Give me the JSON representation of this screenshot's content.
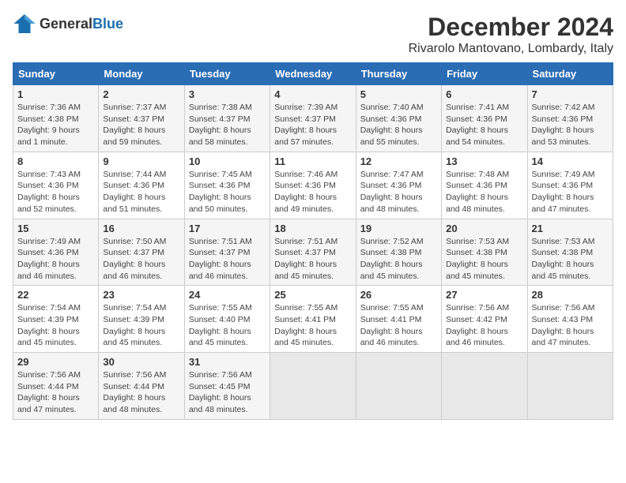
{
  "header": {
    "logo_general": "General",
    "logo_blue": "Blue",
    "title": "December 2024",
    "subtitle": "Rivarolo Mantovano, Lombardy, Italy"
  },
  "weekdays": [
    "Sunday",
    "Monday",
    "Tuesday",
    "Wednesday",
    "Thursday",
    "Friday",
    "Saturday"
  ],
  "weeks": [
    [
      {
        "day": "1",
        "detail": "Sunrise: 7:36 AM\nSunset: 4:38 PM\nDaylight: 9 hours\nand 1 minute."
      },
      {
        "day": "2",
        "detail": "Sunrise: 7:37 AM\nSunset: 4:37 PM\nDaylight: 8 hours\nand 59 minutes."
      },
      {
        "day": "3",
        "detail": "Sunrise: 7:38 AM\nSunset: 4:37 PM\nDaylight: 8 hours\nand 58 minutes."
      },
      {
        "day": "4",
        "detail": "Sunrise: 7:39 AM\nSunset: 4:37 PM\nDaylight: 8 hours\nand 57 minutes."
      },
      {
        "day": "5",
        "detail": "Sunrise: 7:40 AM\nSunset: 4:36 PM\nDaylight: 8 hours\nand 55 minutes."
      },
      {
        "day": "6",
        "detail": "Sunrise: 7:41 AM\nSunset: 4:36 PM\nDaylight: 8 hours\nand 54 minutes."
      },
      {
        "day": "7",
        "detail": "Sunrise: 7:42 AM\nSunset: 4:36 PM\nDaylight: 8 hours\nand 53 minutes."
      }
    ],
    [
      {
        "day": "8",
        "detail": "Sunrise: 7:43 AM\nSunset: 4:36 PM\nDaylight: 8 hours\nand 52 minutes."
      },
      {
        "day": "9",
        "detail": "Sunrise: 7:44 AM\nSunset: 4:36 PM\nDaylight: 8 hours\nand 51 minutes."
      },
      {
        "day": "10",
        "detail": "Sunrise: 7:45 AM\nSunset: 4:36 PM\nDaylight: 8 hours\nand 50 minutes."
      },
      {
        "day": "11",
        "detail": "Sunrise: 7:46 AM\nSunset: 4:36 PM\nDaylight: 8 hours\nand 49 minutes."
      },
      {
        "day": "12",
        "detail": "Sunrise: 7:47 AM\nSunset: 4:36 PM\nDaylight: 8 hours\nand 48 minutes."
      },
      {
        "day": "13",
        "detail": "Sunrise: 7:48 AM\nSunset: 4:36 PM\nDaylight: 8 hours\nand 48 minutes."
      },
      {
        "day": "14",
        "detail": "Sunrise: 7:49 AM\nSunset: 4:36 PM\nDaylight: 8 hours\nand 47 minutes."
      }
    ],
    [
      {
        "day": "15",
        "detail": "Sunrise: 7:49 AM\nSunset: 4:36 PM\nDaylight: 8 hours\nand 46 minutes."
      },
      {
        "day": "16",
        "detail": "Sunrise: 7:50 AM\nSunset: 4:37 PM\nDaylight: 8 hours\nand 46 minutes."
      },
      {
        "day": "17",
        "detail": "Sunrise: 7:51 AM\nSunset: 4:37 PM\nDaylight: 8 hours\nand 46 minutes."
      },
      {
        "day": "18",
        "detail": "Sunrise: 7:51 AM\nSunset: 4:37 PM\nDaylight: 8 hours\nand 45 minutes."
      },
      {
        "day": "19",
        "detail": "Sunrise: 7:52 AM\nSunset: 4:38 PM\nDaylight: 8 hours\nand 45 minutes."
      },
      {
        "day": "20",
        "detail": "Sunrise: 7:53 AM\nSunset: 4:38 PM\nDaylight: 8 hours\nand 45 minutes."
      },
      {
        "day": "21",
        "detail": "Sunrise: 7:53 AM\nSunset: 4:38 PM\nDaylight: 8 hours\nand 45 minutes."
      }
    ],
    [
      {
        "day": "22",
        "detail": "Sunrise: 7:54 AM\nSunset: 4:39 PM\nDaylight: 8 hours\nand 45 minutes."
      },
      {
        "day": "23",
        "detail": "Sunrise: 7:54 AM\nSunset: 4:39 PM\nDaylight: 8 hours\nand 45 minutes."
      },
      {
        "day": "24",
        "detail": "Sunrise: 7:55 AM\nSunset: 4:40 PM\nDaylight: 8 hours\nand 45 minutes."
      },
      {
        "day": "25",
        "detail": "Sunrise: 7:55 AM\nSunset: 4:41 PM\nDaylight: 8 hours\nand 45 minutes."
      },
      {
        "day": "26",
        "detail": "Sunrise: 7:55 AM\nSunset: 4:41 PM\nDaylight: 8 hours\nand 46 minutes."
      },
      {
        "day": "27",
        "detail": "Sunrise: 7:56 AM\nSunset: 4:42 PM\nDaylight: 8 hours\nand 46 minutes."
      },
      {
        "day": "28",
        "detail": "Sunrise: 7:56 AM\nSunset: 4:43 PM\nDaylight: 8 hours\nand 47 minutes."
      }
    ],
    [
      {
        "day": "29",
        "detail": "Sunrise: 7:56 AM\nSunset: 4:44 PM\nDaylight: 8 hours\nand 47 minutes."
      },
      {
        "day": "30",
        "detail": "Sunrise: 7:56 AM\nSunset: 4:44 PM\nDaylight: 8 hours\nand 48 minutes."
      },
      {
        "day": "31",
        "detail": "Sunrise: 7:56 AM\nSunset: 4:45 PM\nDaylight: 8 hours\nand 48 minutes."
      },
      null,
      null,
      null,
      null
    ]
  ]
}
